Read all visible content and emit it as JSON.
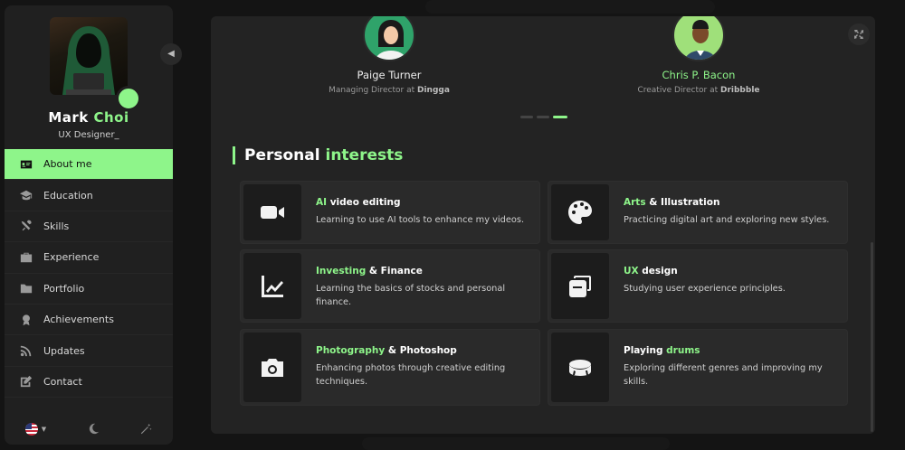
{
  "profile": {
    "name_first": "Mark",
    "name_last": "Choi",
    "role": "UX Designer_",
    "status_color": "#8ef58a"
  },
  "nav": {
    "items": [
      {
        "label": "About me",
        "icon": "id-card-icon",
        "active": true
      },
      {
        "label": "Education",
        "icon": "graduation-cap-icon",
        "active": false
      },
      {
        "label": "Skills",
        "icon": "tools-icon",
        "active": false
      },
      {
        "label": "Experience",
        "icon": "briefcase-icon",
        "active": false
      },
      {
        "label": "Portfolio",
        "icon": "folder-icon",
        "active": false
      },
      {
        "label": "Achievements",
        "icon": "medal-icon",
        "active": false
      },
      {
        "label": "Updates",
        "icon": "rss-icon",
        "active": false
      },
      {
        "label": "Contact",
        "icon": "edit-icon",
        "active": false
      }
    ]
  },
  "footer": {
    "language_icon": "us-flag-icon",
    "theme_icon": "moon-icon",
    "effects_icon": "magic-wand-icon"
  },
  "testimonials": [
    {
      "name": "Paige Turner",
      "role_prefix": "Managing Director at",
      "company": "Dingga"
    },
    {
      "name": "Chris P. Bacon",
      "role_prefix": "Creative Director at",
      "company": "Dribbble"
    }
  ],
  "carousel": {
    "count": 3,
    "active_index": 2
  },
  "interests": {
    "title_plain": "Personal",
    "title_accent": "interests",
    "cards": [
      {
        "icon": "video-camera-icon",
        "title_accent": "AI",
        "title_rest": " video editing",
        "desc": "Learning to use AI tools to enhance my videos."
      },
      {
        "icon": "palette-icon",
        "title_accent": "Arts",
        "title_rest": " & Illustration",
        "desc": "Practicing digital art and exploring new styles."
      },
      {
        "icon": "chart-line-icon",
        "title_accent": "Investing",
        "title_rest": " & Finance",
        "desc": "Learning the basics of stocks and personal finance."
      },
      {
        "icon": "layers-icon",
        "title_accent": "UX",
        "title_rest": " design",
        "desc": "Studying user experience principles."
      },
      {
        "icon": "camera-icon",
        "title_accent": "Photography",
        "title_rest": " & Photoshop",
        "desc": "Enhancing photos through creative editing techniques."
      },
      {
        "icon": "drum-icon",
        "title_pre": "Playing ",
        "title_accent": "drums",
        "desc": "Exploring different genres and improving my skills."
      }
    ]
  },
  "colors": {
    "accent": "#8ef58a",
    "panel": "#232323",
    "sidebar": "#202020"
  }
}
